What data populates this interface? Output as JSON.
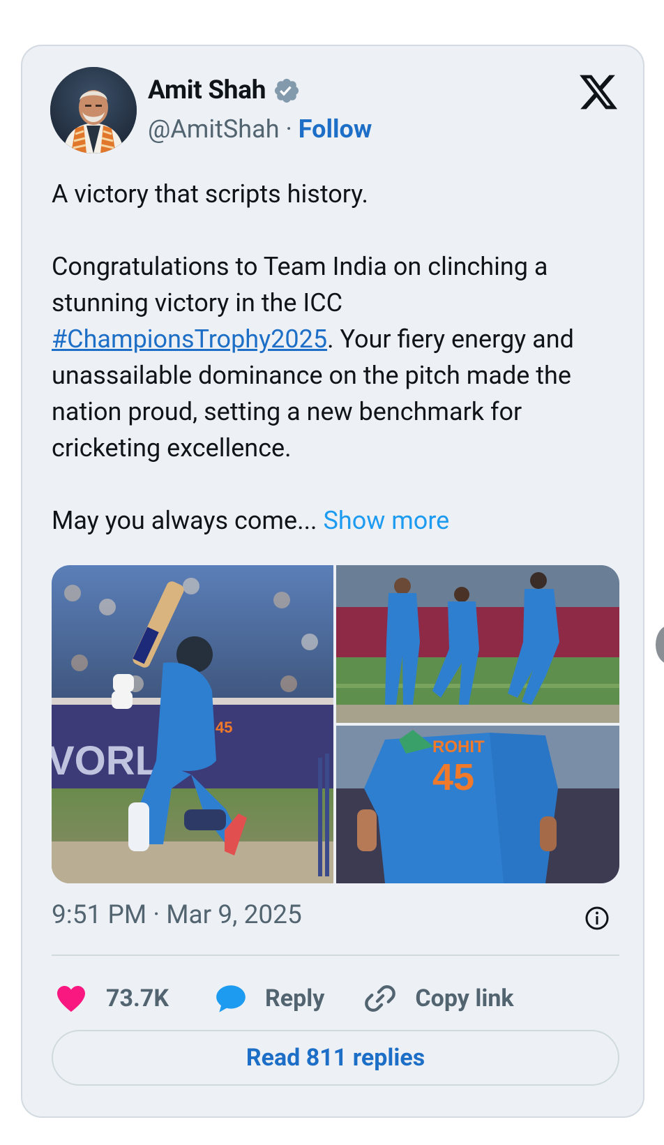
{
  "author": {
    "name": "Amit Shah",
    "handle": "@AmitShah",
    "separator": " · ",
    "follow_label": "Follow",
    "verified_icon": "verified-badge-icon"
  },
  "platform_icon": "x-logo-icon",
  "tweet": {
    "line1": "A victory that scripts history.",
    "para2_start": "Congratulations to Team India on clinching a stunning victory in the ICC ",
    "hashtag": "#ChampionsTrophy2025",
    "para2_end": ". Your fiery energy and unassailable dominance on the pitch made the nation proud, setting a new benchmark for cricketing excellence.",
    "para3": "May you always come...",
    "show_more": "Show more"
  },
  "media": {
    "photo1_jersey_number": "45",
    "photo3_jersey_name": "ROHIT",
    "photo3_jersey_number": "45"
  },
  "timestamp": "9:51 PM · Mar 9, 2025",
  "actions": {
    "likes": "73.7K",
    "reply_label": "Reply",
    "copy_link_label": "Copy link"
  },
  "read_replies_label": "Read 811 replies",
  "colors": {
    "card_bg": "#edf1f5",
    "link_blue": "#1d6ec6",
    "like_pink": "#f91880",
    "reply_blue": "#1d9bf0",
    "muted": "#536471"
  }
}
